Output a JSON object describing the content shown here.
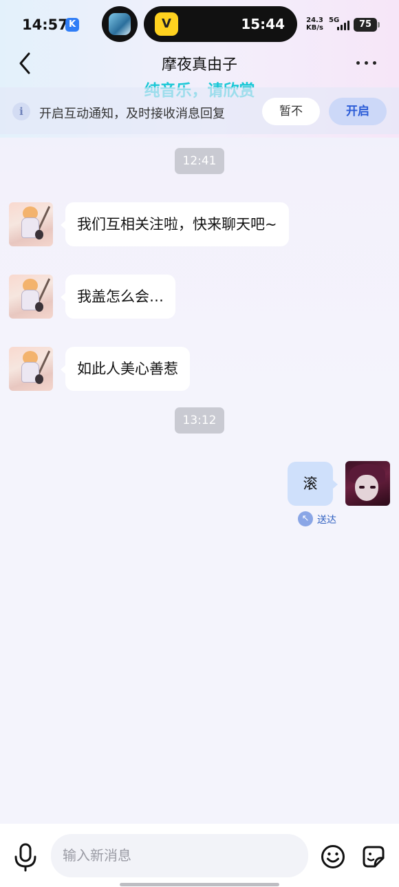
{
  "status_bar": {
    "time": "14:57",
    "carrier_badge": "K",
    "island_time": "15:44",
    "island_app_glyph": "V",
    "net_speed": "24.3",
    "net_speed_unit": "KB/s",
    "network": "5G",
    "battery": "75"
  },
  "header": {
    "title": "摩夜真由子",
    "subtitle": "纯音乐，请欣赏"
  },
  "notice_banner": {
    "text": "开启互动通知，及时接收消息回复",
    "later_label": "暂不",
    "enable_label": "开启"
  },
  "conversation": {
    "time_1": "12:41",
    "time_2": "13:12",
    "incoming": [
      {
        "text": "我们互相关注啦，快来聊天吧~"
      },
      {
        "text": "我盖怎么会…"
      },
      {
        "text": "如此人美心善惹"
      }
    ],
    "outgoing": [
      {
        "text": "滚",
        "status": "送达"
      }
    ]
  },
  "composer": {
    "placeholder": "输入新消息"
  },
  "colors": {
    "accent": "#2a5bd7",
    "subtitle": "#19c8d6",
    "outgoing_bubble": "#cfe0fb",
    "time_chip": "#c9cad2"
  },
  "icons": {
    "back": "chevron-left-icon",
    "more": "more-dots-icon",
    "info": "info-icon",
    "mic": "mic-icon",
    "emoji": "emoji-icon",
    "sticker": "sticker-icon",
    "delivered": "delivered-arrow-icon"
  }
}
